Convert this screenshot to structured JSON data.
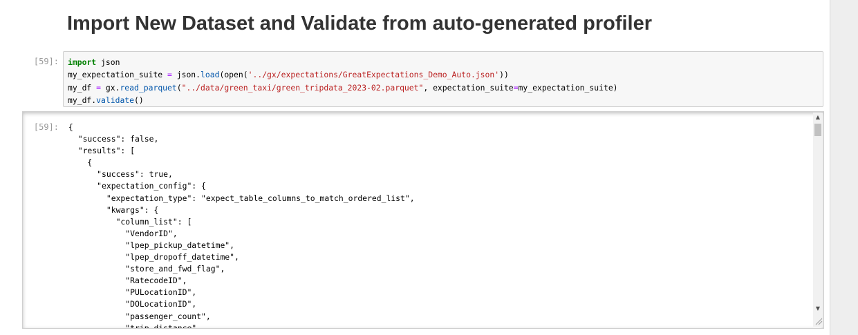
{
  "markdown": {
    "heading": "Import New Dataset and Validate from auto-generated profiler"
  },
  "input_cell": {
    "prompt": "[59]:",
    "lines": [
      [
        {
          "t": "import",
          "c": "kw"
        },
        {
          "t": " json",
          "c": ""
        }
      ],
      [
        {
          "t": "my_expectation_suite ",
          "c": ""
        },
        {
          "t": "=",
          "c": "eq"
        },
        {
          "t": " json.",
          "c": ""
        },
        {
          "t": "load",
          "c": "fn"
        },
        {
          "t": "(open(",
          "c": ""
        },
        {
          "t": "'../gx/expectations/GreatExpectations_Demo_Auto.json'",
          "c": "str"
        },
        {
          "t": "))",
          "c": ""
        }
      ],
      [
        {
          "t": "my_df ",
          "c": ""
        },
        {
          "t": "=",
          "c": "eq"
        },
        {
          "t": " gx.",
          "c": ""
        },
        {
          "t": "read_parquet",
          "c": "fn"
        },
        {
          "t": "(",
          "c": ""
        },
        {
          "t": "\"../data/green_taxi/green_tripdata_2023-02.parquet\"",
          "c": "str"
        },
        {
          "t": ", expectation_suite",
          "c": ""
        },
        {
          "t": "=",
          "c": "eq"
        },
        {
          "t": "my_expectation_suite)",
          "c": ""
        }
      ],
      [
        {
          "t": "my_df.",
          "c": ""
        },
        {
          "t": "validate",
          "c": "fn"
        },
        {
          "t": "()",
          "c": ""
        }
      ]
    ]
  },
  "output_cell": {
    "prompt": "[59]:",
    "lines": [
      "{",
      "  \"success\": false,",
      "  \"results\": [",
      "    {",
      "      \"success\": true,",
      "      \"expectation_config\": {",
      "        \"expectation_type\": \"expect_table_columns_to_match_ordered_list\",",
      "        \"kwargs\": {",
      "          \"column_list\": [",
      "            \"VendorID\",",
      "            \"lpep_pickup_datetime\",",
      "            \"lpep_dropoff_datetime\",",
      "            \"store_and_fwd_flag\",",
      "            \"RatecodeID\",",
      "            \"PULocationID\",",
      "            \"DOLocationID\",",
      "            \"passenger_count\",",
      "            \"trip_distance\","
    ]
  },
  "scrollbar": {
    "up_icon": "▲",
    "down_icon": "▼"
  }
}
